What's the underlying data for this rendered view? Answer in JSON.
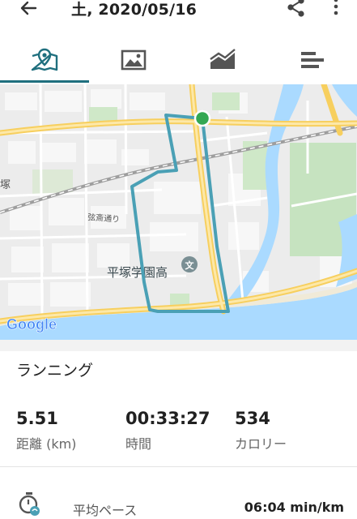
{
  "header": {
    "title": "土, 2020/05/16",
    "back_icon": "back-arrow-icon",
    "share_icon": "share-icon",
    "more_icon": "more-vert-icon"
  },
  "tabs": [
    {
      "name": "map-tab",
      "icon": "map-pin-icon",
      "active": true
    },
    {
      "name": "photo-tab",
      "icon": "image-icon",
      "active": false
    },
    {
      "name": "chart-tab",
      "icon": "area-chart-icon",
      "active": false
    },
    {
      "name": "laps-tab",
      "icon": "bars-icon",
      "active": false
    }
  ],
  "map": {
    "labels": {
      "school": "平塚学園高",
      "street": "弦斎通り",
      "left_edge": "塚",
      "google": "Google"
    },
    "route_color": "#4aa0b5",
    "start_marker_color": "#34a853"
  },
  "activity": {
    "type": "ランニング"
  },
  "stats": {
    "distance": {
      "value": "5.51",
      "label": "距離 (km)"
    },
    "duration": {
      "value": "00:33:27",
      "label": "時間"
    },
    "calories": {
      "value": "534",
      "label": "カロリー"
    }
  },
  "pace": {
    "label": "平均ペース",
    "value": "06:04 min/km"
  },
  "colors": {
    "accent": "#1f6f7e",
    "water": "#aadaff",
    "park": "#c8e6c9",
    "road_major": "#f9d26b"
  }
}
